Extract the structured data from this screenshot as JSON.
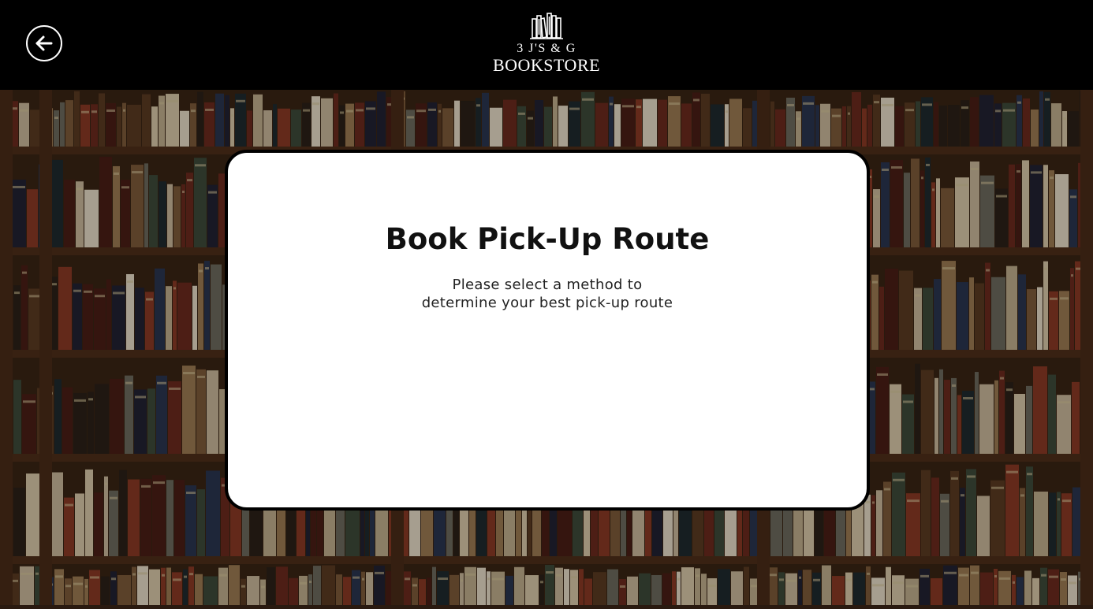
{
  "header": {
    "back_button": {
      "icon": "arrow-left-icon"
    },
    "logo": {
      "icon": "bookshelf-icon",
      "line1": "3 J'S & G",
      "line2": "BOOKSTORE"
    }
  },
  "background": {
    "description_icon": "bookshelf-photo"
  },
  "card": {
    "title": "Book Pick-Up Route",
    "subtitle_line1": "Please select a method to",
    "subtitle_line2": "determine your best pick-up route"
  },
  "colors": {
    "header_bg": "#000000",
    "card_bg": "#ffffff",
    "card_border": "#000000",
    "text": "#111111"
  }
}
